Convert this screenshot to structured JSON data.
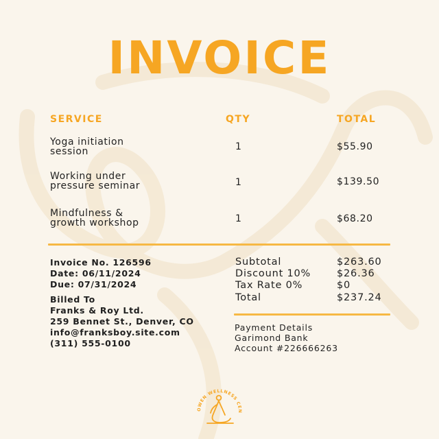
{
  "title": "INVOICE",
  "columns": {
    "service": "SERVICE",
    "qty": "QTY",
    "total": "TOTAL"
  },
  "items": [
    {
      "line1": "Yoga initiation",
      "line2": "session",
      "qty": "1",
      "total": "$55.90"
    },
    {
      "line1": "Working under",
      "line2": "pressure seminar",
      "qty": "1",
      "total": "$139.50"
    },
    {
      "line1": "Mindfulness &",
      "line2": "growth workshop",
      "qty": "1",
      "total": "$68.20"
    }
  ],
  "invoice_info": {
    "number": "Invoice No. 126596",
    "date": "Date: 06/11/2024",
    "due": "Due: 07/31/2024"
  },
  "billed_to": {
    "heading": "Billed To",
    "name": "Franks & Roy Ltd.",
    "address": "259 Bennet St., Denver, CO",
    "email": "info@franksboy.site.com",
    "phone": "(311) 555-0100"
  },
  "summary": [
    {
      "label": "Subtotal",
      "value": "$263.60"
    },
    {
      "label": "Discount 10%",
      "value": "$26.36"
    },
    {
      "label": "Tax Rate 0%",
      "value": "$0"
    },
    {
      "label": "Total",
      "value": "$237.24"
    }
  ],
  "payment": {
    "heading": "Payment Details",
    "bank": "Garimond Bank",
    "account": "Account #226666263"
  },
  "logo_text": "OWEN WELLNESS CENTER",
  "colors": {
    "accent": "#f6a623",
    "background": "#faf5ec",
    "text": "#1f1f1f"
  }
}
